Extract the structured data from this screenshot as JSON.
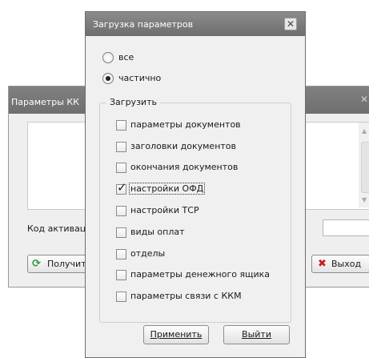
{
  "background_window": {
    "title": "Параметры КК",
    "close_glyph": "✕",
    "activation_label": "Код активаци",
    "get_button": "Получит",
    "exit_button": "Выход"
  },
  "dialog": {
    "title": "Загрузка параметров",
    "close_glyph": "✕",
    "radios": [
      {
        "label": "все",
        "selected": false
      },
      {
        "label": "частично",
        "selected": true
      }
    ],
    "group_label": "Загрузить",
    "checkboxes": [
      {
        "label": "параметры документов",
        "checked": false
      },
      {
        "label": "заголовки документов",
        "checked": false
      },
      {
        "label": "окончания документов",
        "checked": false
      },
      {
        "label": "настройки ОФД",
        "checked": true
      },
      {
        "label": "настройки ТСР",
        "checked": false
      },
      {
        "label": "виды оплат",
        "checked": false
      },
      {
        "label": "отделы",
        "checked": false
      },
      {
        "label": "параметры денежного ящика",
        "checked": false
      },
      {
        "label": "параметры связи с ККМ",
        "checked": false
      }
    ],
    "apply_button": "Применить",
    "exit_button": "Выйти"
  },
  "icons": {
    "check": "✓",
    "refresh": "⟳",
    "exit_x": "✖"
  },
  "colors": {
    "title_bar": "#7a7a7a",
    "refresh_icon": "#2e9a3a",
    "exit_icon": "#c81e1e"
  }
}
